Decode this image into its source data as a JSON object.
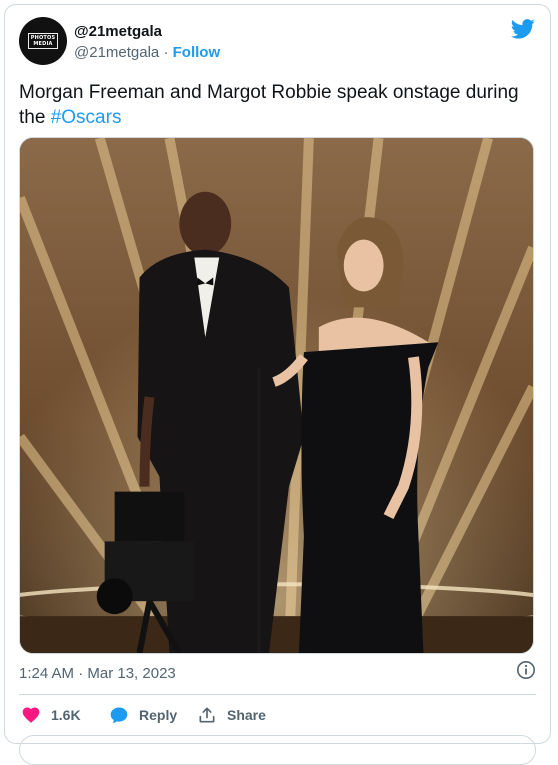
{
  "author": {
    "display_name": "@21metgala",
    "handle": "@21metgala",
    "separator": " · ",
    "follow_label": "Follow",
    "avatar_text": "PHOTOS MEDIA"
  },
  "tweet": {
    "text_before": "Morgan Freeman and Margot Robbie speak onstage during the ",
    "hashtag": "#Oscars"
  },
  "photo": {
    "alt": "Morgan Freeman and Margot Robbie onstage at the Oscars"
  },
  "meta": {
    "timestamp": "1:24 AM · Mar 13, 2023"
  },
  "actions": {
    "like_count": "1.6K",
    "reply_label": "Reply",
    "share_label": "Share"
  },
  "colors": {
    "accent": "#1d9bf0",
    "like": "#f91880",
    "text_secondary": "#536471",
    "border": "#cfd9de"
  },
  "icons": [
    "twitter-bird-icon",
    "info-icon",
    "heart-icon",
    "reply-bubble-icon",
    "share-icon"
  ]
}
